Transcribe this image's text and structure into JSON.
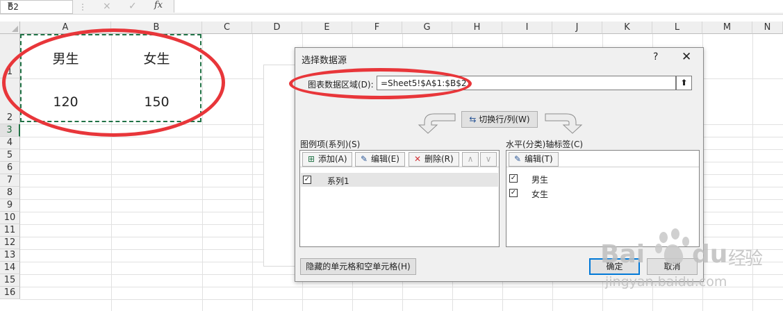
{
  "formula_bar": {
    "name_box": "B2",
    "cancel_icon": "×",
    "enter_icon": "✓",
    "fx_label": "fx",
    "formula": ""
  },
  "sheet": {
    "columns": [
      "A",
      "B",
      "C",
      "D",
      "E",
      "F",
      "G",
      "H",
      "I",
      "J",
      "K",
      "L",
      "M",
      "N"
    ],
    "rows": [
      "1",
      "2",
      "3",
      "4",
      "5",
      "6",
      "7",
      "8",
      "9",
      "10",
      "11",
      "12",
      "13",
      "14",
      "15",
      "16"
    ],
    "cells": {
      "A1": "男生",
      "B1": "女生",
      "A2": "120",
      "B2": "150"
    }
  },
  "dialog": {
    "title": "选择数据源",
    "help": "?",
    "close": "✕",
    "range_label": "图表数据区域(D):",
    "range_value": "=Sheet5!$A$1:$B$2",
    "collapse_icon": "⬆",
    "switch_label": "切换行/列(W)",
    "legend": {
      "label": "图例项(系列)(S)",
      "add": "添加(A)",
      "edit": "编辑(E)",
      "delete": "删除(R)",
      "up": "∧",
      "down": "∨",
      "items": [
        {
          "checked": true,
          "label": "系列1"
        }
      ]
    },
    "axis": {
      "label": "水平(分类)轴标签(C)",
      "edit": "编辑(T)",
      "items": [
        {
          "checked": true,
          "label": "男生"
        },
        {
          "checked": true,
          "label": "女生"
        }
      ]
    },
    "hidden_cells": "隐藏的单元格和空单元格(H)",
    "ok": "确定",
    "cancel": "取消"
  },
  "watermark": {
    "brand": "Bai",
    "brand2": "du",
    "product": "经验",
    "url": "jingyan.baidu.com"
  },
  "colors": {
    "excel_green": "#217346",
    "annotation_red": "#e8363a",
    "dialog_bg": "#f0f0f0",
    "focus_blue": "#0078d7"
  }
}
